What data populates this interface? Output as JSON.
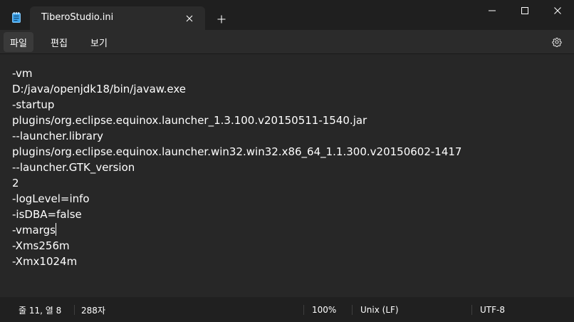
{
  "titlebar": {
    "tab_title": "TiberoStudio.ini",
    "close_tab_icon": "close-icon",
    "new_tab_icon": "plus-icon",
    "app_icon": "notepad-icon"
  },
  "menu": {
    "file": "파일",
    "edit": "편집",
    "view": "보기",
    "settings_icon": "gear-icon"
  },
  "editor": {
    "lines": [
      "-vm",
      "D:/java/openjdk18/bin/javaw.exe",
      "-startup",
      "plugins/org.eclipse.equinox.launcher_1.3.100.v20150511-1540.jar",
      "--launcher.library",
      "plugins/org.eclipse.equinox.launcher.win32.win32.x86_64_1.1.300.v20150602-1417",
      "--launcher.GTK_version",
      "2",
      "-logLevel=info",
      "-isDBA=false",
      "-vmargs",
      "-Xms256m",
      "-Xmx1024m"
    ]
  },
  "statusbar": {
    "position": "줄 11, 열 8",
    "char_count": "288자",
    "zoom": "100%",
    "line_ending": "Unix (LF)",
    "encoding": "UTF-8"
  }
}
